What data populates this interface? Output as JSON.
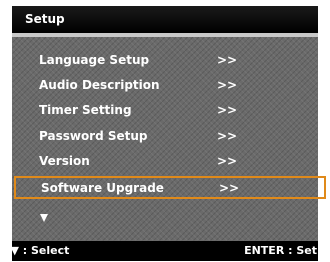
{
  "menu": {
    "title": "Setup",
    "items": [
      {
        "label": "Language Setup",
        "arrow": ">>"
      },
      {
        "label": "Audio Description",
        "arrow": ">>"
      },
      {
        "label": "Timer Setting",
        "arrow": ">>"
      },
      {
        "label": "Password Setup",
        "arrow": ">>"
      },
      {
        "label": "Version",
        "arrow": ">>"
      },
      {
        "label": "Software Upgrade",
        "arrow": ">>"
      }
    ],
    "selected_item": "Software Upgrade",
    "more_indicator_icon": "down-triangle-icon"
  },
  "footer": {
    "select_hint": "▲▼ : Select",
    "enter_hint": "ENTER : Set"
  },
  "colors": {
    "title_bar": "#000000",
    "menu_background": "#6a6a6a",
    "selection_border": "#e08a1a",
    "text": "#ffffff"
  }
}
